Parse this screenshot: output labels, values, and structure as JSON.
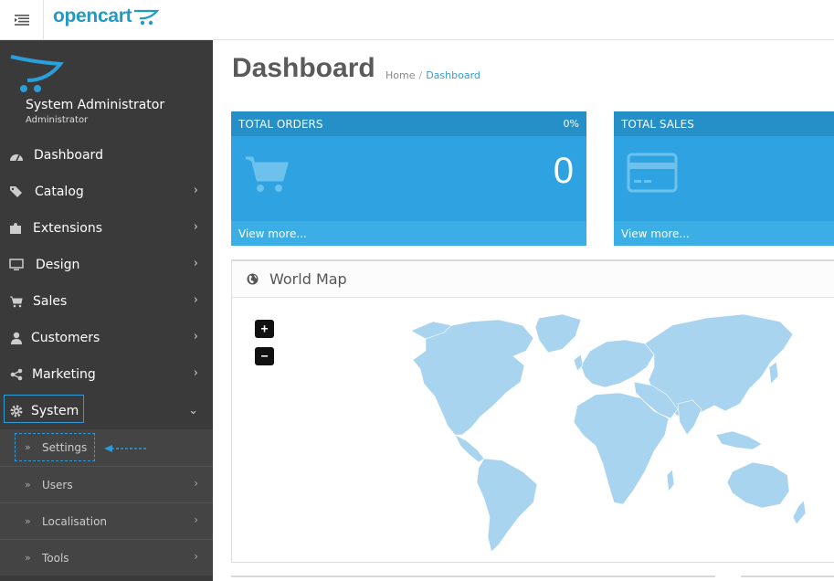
{
  "header": {
    "logo_text": "opencart",
    "brand_color": "#229ac8"
  },
  "sidebar": {
    "profile": {
      "name": "System Administrator",
      "role": "Administrator"
    },
    "items": [
      {
        "label": "Dashboard",
        "icon": "dashboard-icon",
        "has_children": false
      },
      {
        "label": "Catalog",
        "icon": "tags-icon",
        "has_children": true
      },
      {
        "label": "Extensions",
        "icon": "puzzle-icon",
        "has_children": true
      },
      {
        "label": "Design",
        "icon": "monitor-icon",
        "has_children": true
      },
      {
        "label": "Sales",
        "icon": "cart-icon",
        "has_children": true
      },
      {
        "label": "Customers",
        "icon": "user-icon",
        "has_children": true
      },
      {
        "label": "Marketing",
        "icon": "share-icon",
        "has_children": true
      },
      {
        "label": "System",
        "icon": "gear-icon",
        "has_children": true,
        "expanded": true
      }
    ],
    "system_children": [
      {
        "label": "Settings",
        "has_children": false
      },
      {
        "label": "Users",
        "has_children": true
      },
      {
        "label": "Localisation",
        "has_children": true
      },
      {
        "label": "Tools",
        "has_children": true
      }
    ]
  },
  "main": {
    "title": "Dashboard",
    "breadcrumb": [
      {
        "label": "Home"
      },
      {
        "label": "Dashboard"
      }
    ],
    "tiles": [
      {
        "title": "TOTAL ORDERS",
        "percent": "0%",
        "value": "0",
        "link": "View more...",
        "icon": "shopping-cart-icon"
      },
      {
        "title": "TOTAL SALES",
        "percent": "",
        "value": "",
        "link": "View more...",
        "icon": "credit-card-icon"
      }
    ],
    "map": {
      "title": "World Map",
      "zoom_in": "+",
      "zoom_out": "−"
    }
  },
  "colors": {
    "sidebar_bg": "#3a3a3a",
    "tile_bg": "#2fa3e1",
    "highlight_border": "#2e9ad7",
    "map_land": "#a8d4f0"
  }
}
